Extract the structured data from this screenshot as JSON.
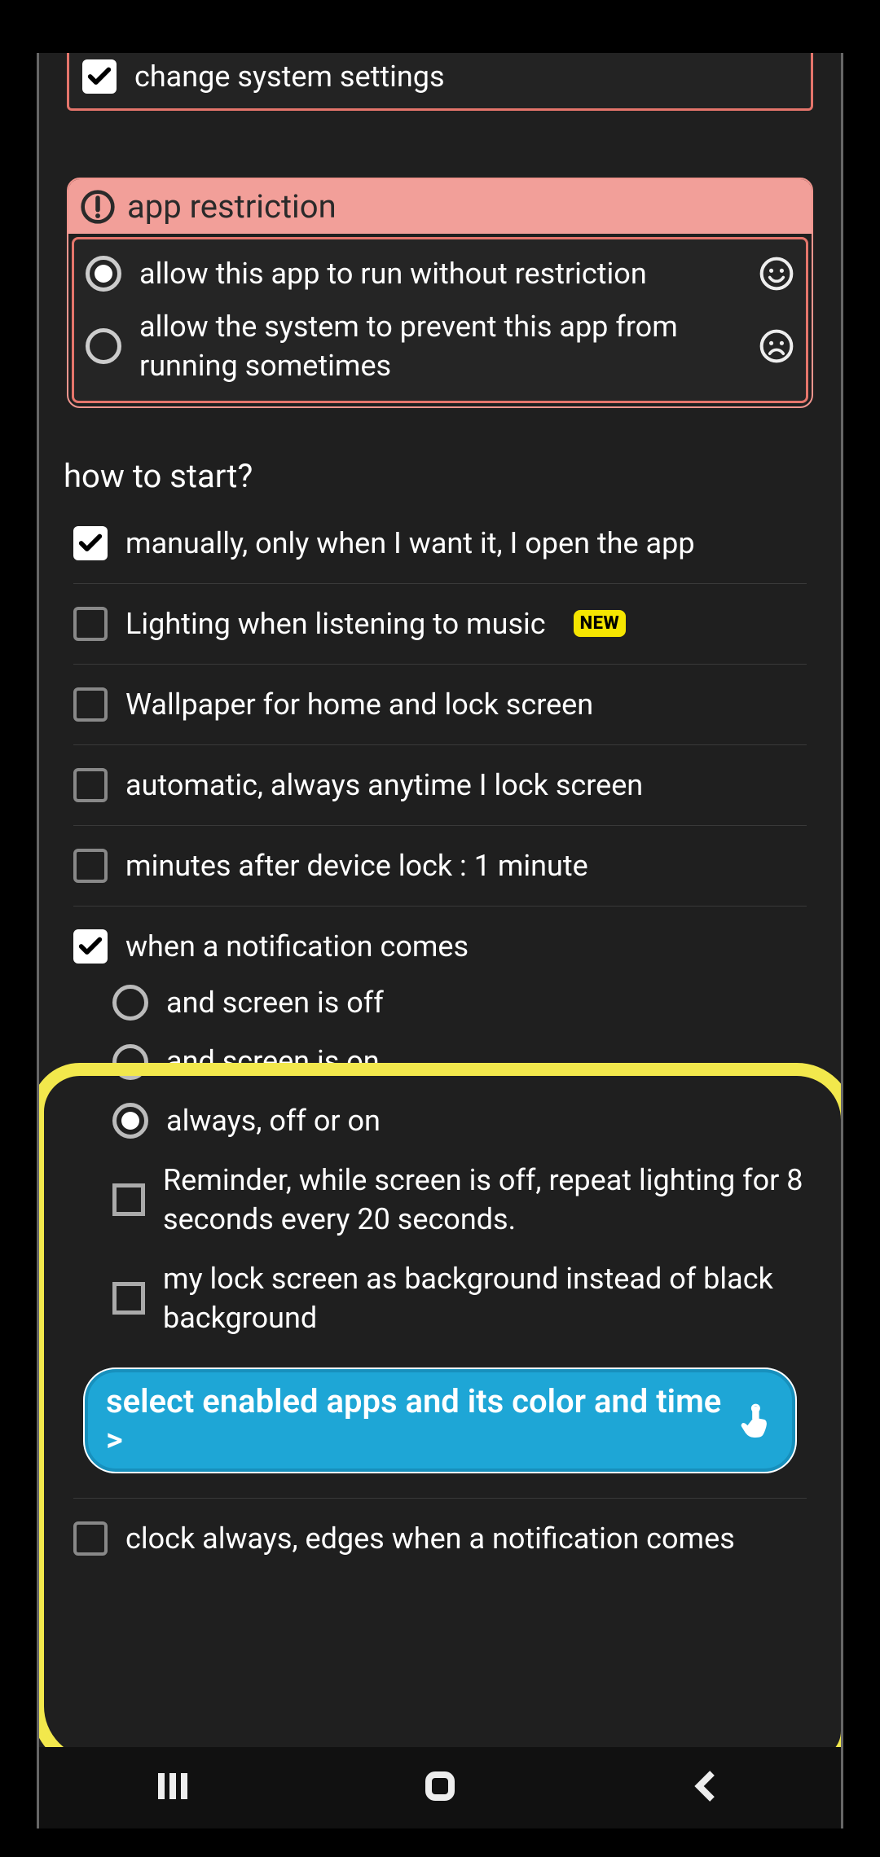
{
  "top_permission": {
    "change_system_settings": "change system settings"
  },
  "restriction": {
    "title": "app restriction",
    "allow_no_restrict": "allow this app to run without restriction",
    "allow_prevent": "allow the system to prevent this app from running sometimes"
  },
  "how_to_start_heading": "how to start?",
  "options": {
    "manually": "manually, only when I want it, I open the app",
    "lighting_music": "Lighting when listening to music",
    "new_badge": "NEW",
    "wallpaper": "Wallpaper for home and lock screen",
    "automatic_lock": "automatic, always anytime I lock screen",
    "minutes_after": "minutes after device lock : 1 minute",
    "notification": "when a notification comes",
    "clock_always": "clock always, edges when a notification comes"
  },
  "notification_sub": {
    "screen_off": "and screen is off",
    "screen_on": "and screen is on",
    "always": "always, off or on",
    "reminder": "Reminder, while screen is off, repeat lighting for 8 seconds every 20 seconds.",
    "lockscreen_bg": "my lock screen as background instead of black background"
  },
  "action_button": "select enabled apps and its color and time >"
}
